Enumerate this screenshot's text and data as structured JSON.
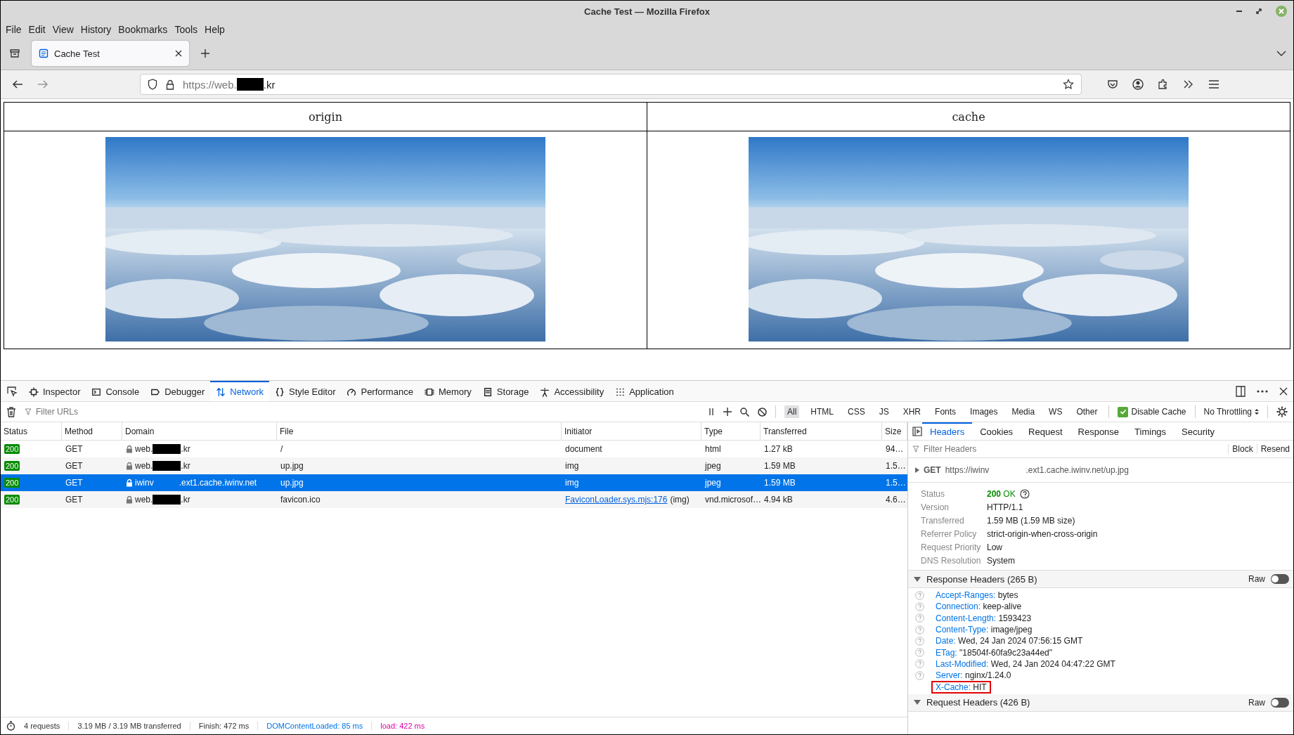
{
  "window": {
    "title": "Cache Test — Mozilla Firefox"
  },
  "menu": [
    "File",
    "Edit",
    "View",
    "History",
    "Bookmarks",
    "Tools",
    "Help"
  ],
  "tabs": [
    {
      "label": "Cache Test",
      "selected": true
    }
  ],
  "address": {
    "url_start": "https://web.",
    "url_end": ".kr"
  },
  "page": {
    "columns": [
      "origin",
      "cache"
    ]
  },
  "devtools": {
    "tools": [
      {
        "label": "Inspector",
        "selected": false
      },
      {
        "label": "Console",
        "selected": false
      },
      {
        "label": "Debugger",
        "selected": false
      },
      {
        "label": "Network",
        "selected": true
      },
      {
        "label": "Style Editor",
        "selected": false
      },
      {
        "label": "Performance",
        "selected": false
      },
      {
        "label": "Memory",
        "selected": false
      },
      {
        "label": "Storage",
        "selected": false
      },
      {
        "label": "Accessibility",
        "selected": false
      },
      {
        "label": "Application",
        "selected": false
      }
    ],
    "filter_placeholder": "Filter URLs",
    "request_types": [
      {
        "label": "All",
        "selected": true
      },
      {
        "label": "HTML",
        "selected": false
      },
      {
        "label": "CSS",
        "selected": false
      },
      {
        "label": "JS",
        "selected": false
      },
      {
        "label": "XHR",
        "selected": false
      },
      {
        "label": "Fonts",
        "selected": false
      },
      {
        "label": "Images",
        "selected": false
      },
      {
        "label": "Media",
        "selected": false
      },
      {
        "label": "WS",
        "selected": false
      },
      {
        "label": "Other",
        "selected": false
      }
    ],
    "disable_cache": {
      "label": "Disable Cache",
      "checked": true
    },
    "throttling": "No Throttling",
    "columns": [
      "Status",
      "Method",
      "Domain",
      "File",
      "Initiator",
      "Type",
      "Transferred",
      "Size"
    ],
    "rows": [
      {
        "status": "200",
        "method": "GET",
        "domain": [
          "web.",
          ".kr"
        ],
        "redacted": true,
        "file": "/",
        "initiator": "document",
        "type": "html",
        "transferred": "1.27 kB",
        "size": "94…",
        "selected": false
      },
      {
        "status": "200",
        "method": "GET",
        "domain": [
          "web.",
          ".kr"
        ],
        "redacted": true,
        "file": "up.jpg",
        "initiator": "img",
        "type": "jpeg",
        "transferred": "1.59 MB",
        "size": "1.5…",
        "selected": false
      },
      {
        "status": "200",
        "method": "GET",
        "domain": [
          "iwinv",
          ".ext1.cache.iwinv.net"
        ],
        "redacted": false,
        "file": "up.jpg",
        "initiator": "img",
        "type": "jpeg",
        "transferred": "1.59 MB",
        "size": "1.5…",
        "selected": true
      },
      {
        "status": "200",
        "method": "GET",
        "domain": [
          "web.",
          ".kr"
        ],
        "redacted": true,
        "file": "favicon.ico",
        "initiator_link": "FaviconLoader.sys.mjs:176",
        "initiator": "(img)",
        "type": "vnd.microsof…",
        "transferred": "4.94 kB",
        "size": "4.6…",
        "selected": false
      }
    ],
    "status_bar": [
      {
        "text": "4 requests",
        "color": "#333333"
      },
      {
        "text": "3.19 MB / 3.19 MB transferred",
        "color": "#333333"
      },
      {
        "text": "Finish: 472 ms",
        "color": "#333333"
      },
      {
        "text": "DOMContentLoaded: 85 ms",
        "color": "#0074e8"
      },
      {
        "text": "load: 422 ms",
        "color": "#dd00a9"
      }
    ],
    "details": {
      "tabs": [
        {
          "label": "Headers",
          "selected": true
        },
        {
          "label": "Cookies",
          "selected": false
        },
        {
          "label": "Request",
          "selected": false
        },
        {
          "label": "Response",
          "selected": false
        },
        {
          "label": "Timings",
          "selected": false
        },
        {
          "label": "Security",
          "selected": false
        }
      ],
      "filter_placeholder": "Filter Headers",
      "actions": [
        "Block",
        "Resend"
      ],
      "request_line": {
        "method": "GET",
        "url": [
          "https://iwinv",
          ".ext1.cache.iwinv.net/up.jpg"
        ]
      },
      "summary": [
        {
          "label": "Status",
          "kind": "status",
          "code": "200",
          "value": "OK"
        },
        {
          "label": "Version",
          "kind": "text",
          "value": "HTTP/1.1"
        },
        {
          "label": "Transferred",
          "kind": "text",
          "value": "1.59 MB (1.59 MB size)"
        },
        {
          "label": "Referrer Policy",
          "kind": "text",
          "value": "strict-origin-when-cross-origin"
        },
        {
          "label": "Request Priority",
          "kind": "text",
          "value": "Low"
        },
        {
          "label": "DNS Resolution",
          "kind": "text",
          "value": "System"
        }
      ],
      "response_headers": {
        "title": "Response Headers (265 B)",
        "expanded": true,
        "raw_label": "Raw",
        "raw_on": false,
        "headers": [
          {
            "name": "Accept-Ranges:",
            "value": "bytes",
            "help": true,
            "highlighted": false
          },
          {
            "name": "Connection:",
            "value": "keep-alive",
            "help": true,
            "highlighted": false
          },
          {
            "name": "Content-Length:",
            "value": "1593423",
            "help": true,
            "highlighted": false
          },
          {
            "name": "Content-Type:",
            "value": "image/jpeg",
            "help": true,
            "highlighted": false
          },
          {
            "name": "Date:",
            "value": "Wed, 24 Jan 2024 07:56:15 GMT",
            "help": true,
            "highlighted": false
          },
          {
            "name": "ETag:",
            "value": "\"18504f-60fa9c23a44ed\"",
            "help": true,
            "highlighted": false
          },
          {
            "name": "Last-Modified:",
            "value": "Wed, 24 Jan 2024 04:47:22 GMT",
            "help": true,
            "highlighted": false
          },
          {
            "name": "Server:",
            "value": "nginx/1.24.0",
            "help": true,
            "highlighted": false
          },
          {
            "name": "X-Cache:",
            "value": "HIT",
            "help": false,
            "highlighted": true
          }
        ]
      },
      "request_headers": {
        "title": "Request Headers (426 B)",
        "expanded": true,
        "raw_label": "Raw",
        "raw_on": false
      }
    }
  }
}
